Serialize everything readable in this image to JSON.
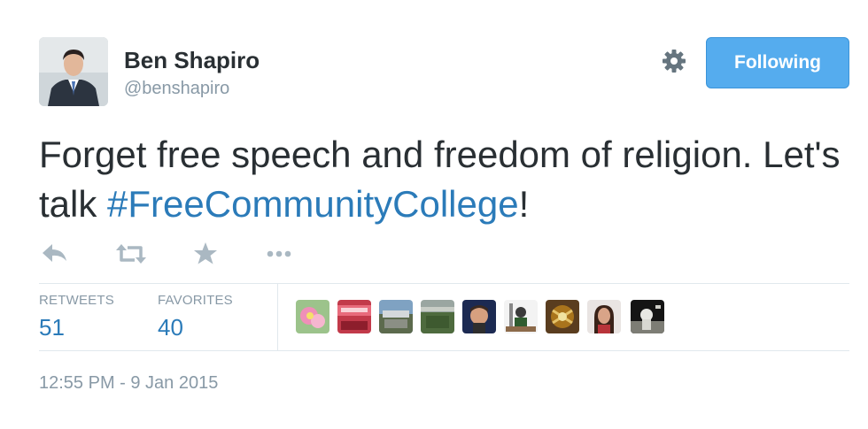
{
  "user": {
    "name": "Ben Shapiro",
    "handle": "@benshapiro"
  },
  "follow_button": {
    "label": "Following",
    "color": "#55acee"
  },
  "tweet": {
    "text_before": "Forget free speech and freedom of religion. Let's talk ",
    "hashtag": "#FreeCommunityCollege",
    "text_after": "!",
    "link_color": "#2b7bb9"
  },
  "actions": [
    "reply-icon",
    "retweet-icon",
    "favorite-icon",
    "more-icon"
  ],
  "stats": {
    "retweets_label": "RETWEETS",
    "retweets_count": "51",
    "favorites_label": "FAVORITES",
    "favorites_count": "40"
  },
  "favoriter_avatars": 9,
  "timestamp": "12:55 PM - 9 Jan 2015"
}
